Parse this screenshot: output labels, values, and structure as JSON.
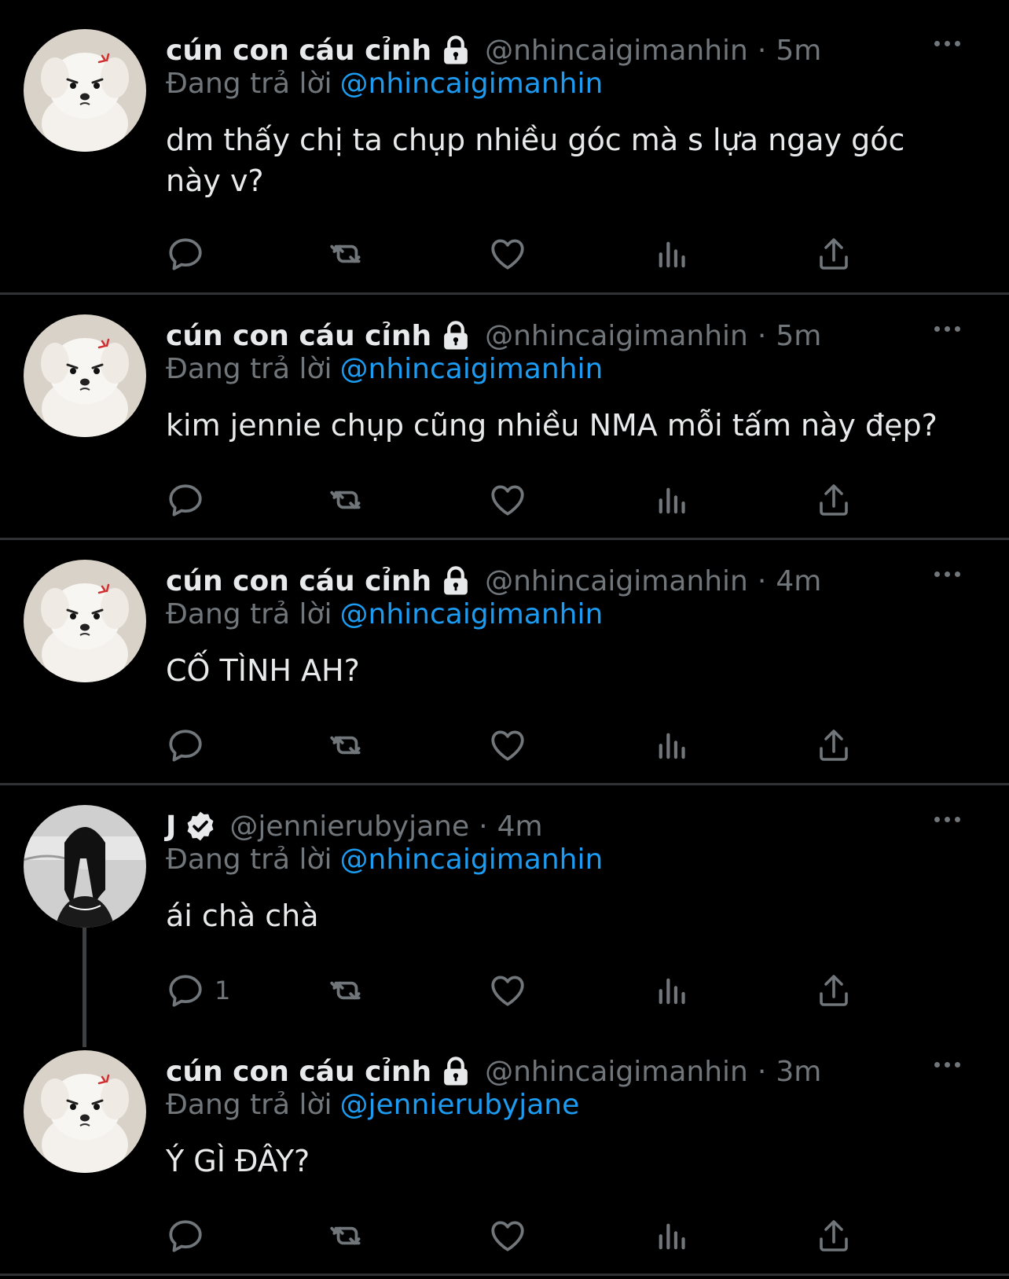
{
  "tweets": [
    {
      "name": "cún con cáu cỉnh",
      "handle": "@nhincaigimanhin",
      "time": "5m",
      "reply_prefix": "Đang trả lời",
      "reply_to": "@nhincaigimanhin",
      "text": "dm thấy chị ta chụp nhiều góc mà s lựa ngay góc này v?",
      "reply_count": ""
    },
    {
      "name": "cún con cáu cỉnh",
      "handle": "@nhincaigimanhin",
      "time": "5m",
      "reply_prefix": "Đang trả lời",
      "reply_to": "@nhincaigimanhin",
      "text": "kim jennie chụp cũng nhiều NMA mỗi tấm này đẹp?",
      "reply_count": ""
    },
    {
      "name": "cún con cáu cỉnh",
      "handle": "@nhincaigimanhin",
      "time": "4m",
      "reply_prefix": "Đang trả lời",
      "reply_to": "@nhincaigimanhin",
      "text": "CỐ TÌNH AH?",
      "reply_count": ""
    },
    {
      "name": "J",
      "handle": "@jennierubyjane",
      "time": "4m",
      "reply_prefix": "Đang trả lời",
      "reply_to": "@nhincaigimanhin",
      "text": "ái chà chà",
      "reply_count": "1"
    },
    {
      "name": "cún con cáu cỉnh",
      "handle": "@nhincaigimanhin",
      "time": "3m",
      "reply_prefix": "Đang trả lời",
      "reply_to": "@jennierubyjane",
      "text": "Ý GÌ ĐÂY?",
      "reply_count": ""
    }
  ],
  "separator": "·",
  "icons": {
    "lock": "lock-icon",
    "verified": "verified-badge-icon",
    "reply": "reply-icon",
    "retweet": "retweet-icon",
    "like": "heart-icon",
    "views": "analytics-icon",
    "share": "share-icon",
    "more": "more-icon"
  },
  "colors": {
    "background": "#000000",
    "text": "#e7e9ea",
    "muted": "#71767b",
    "link": "#1d9bf0",
    "divider": "#2f3336"
  }
}
